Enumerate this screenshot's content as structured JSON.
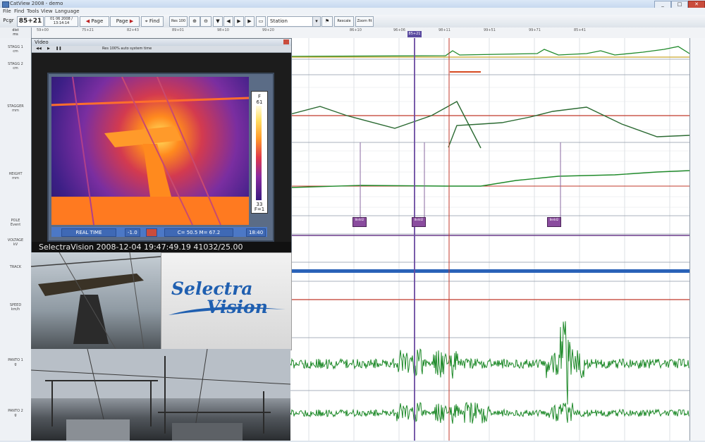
{
  "window": {
    "title": "CatView 2008 - demo"
  },
  "menu": [
    "File",
    "Find",
    "Tools",
    "View",
    "Language"
  ],
  "toolbar": {
    "pole_label": "Pcgr",
    "pole_value": "85+21",
    "position_info": "01 06 2008 / 13:14:14",
    "page_prev": "Page",
    "page_next": "Page",
    "find": "Find",
    "zoom": "Res 100",
    "station_select": "Station",
    "btn_rescale": "Rescale",
    "btn_zoom": "Zoom fit"
  },
  "ruler": {
    "ticks": [
      "59+00",
      "75+21",
      "82+43",
      "89+01",
      "98+10",
      "99+20",
      "85+21",
      "86+10",
      "96+06",
      "98+11",
      "99+51",
      "99+71",
      "85+41"
    ],
    "active_marker": "85+21"
  },
  "axis_corner": {
    "line1": "dist",
    "line2": "ms"
  },
  "channels": [
    {
      "id": "stagg1",
      "name": "STAGG 1",
      "unit": "cm"
    },
    {
      "id": "stagg2",
      "name": "STAGG 2",
      "unit": "cm"
    },
    {
      "id": "stagger",
      "name": "STAGGER",
      "unit": "mm"
    },
    {
      "id": "height",
      "name": "HEIGHT",
      "unit": "mm"
    },
    {
      "id": "pole",
      "name": "POLE",
      "unit": "Event"
    },
    {
      "id": "voltage",
      "name": "VOLTAGE",
      "unit": "kV"
    },
    {
      "id": "track",
      "name": "TRACK",
      "unit": ""
    },
    {
      "id": "speed",
      "name": "SPEED",
      "unit": "km/h"
    },
    {
      "id": "accel1",
      "name": "PANTO 1",
      "unit": "g"
    },
    {
      "id": "accel2",
      "name": "PANTO 2",
      "unit": "g"
    }
  ],
  "cursor_events": [
    "8e4d2",
    "8e4d2",
    "8e4d2"
  ],
  "video": {
    "title": "Video",
    "tool_info": "Res 100%  auto system time",
    "caption": "SelectraVision 2008-12-04 19:47:49.19  41032/25.00"
  },
  "thermal": {
    "scale_unit": "F",
    "scale_max": "61",
    "scale_min": "33",
    "scale_mode": "F=1",
    "status_mode": "REAL TIME",
    "status_value": "-1.0",
    "status_readout": "C= 50.5 M= 67.2",
    "status_time": "18:40"
  },
  "logo": {
    "line1": "Selectra",
    "line2": "Vision"
  },
  "colors": {
    "signal_green": "#1f8a2a",
    "marker_red": "#c0392b",
    "cursor_purple": "#6a4aa0",
    "track_blue": "#2a62b8"
  }
}
